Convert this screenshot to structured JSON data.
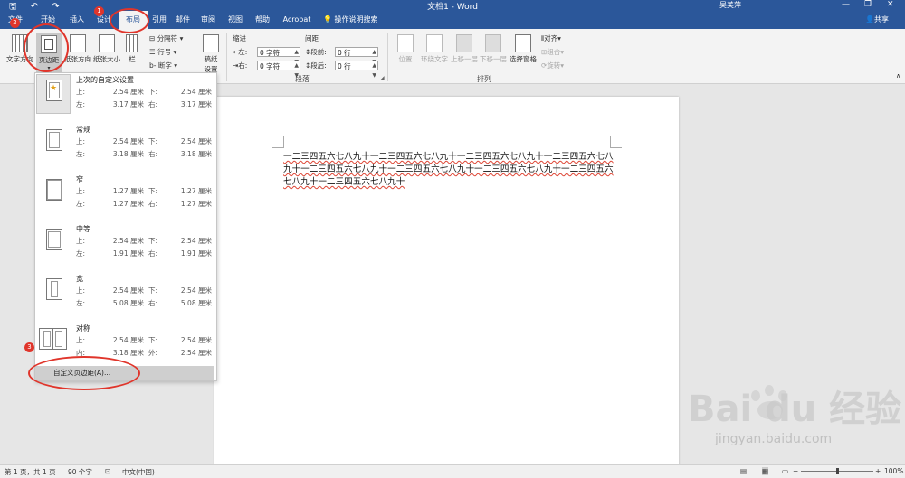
{
  "titlebar": {
    "quick_access": "🖫 ↶ ↷",
    "title": "文档1 - Word",
    "user": "吴美萍",
    "minimize": "—",
    "restore": "❐",
    "close": "✕"
  },
  "tabs": [
    {
      "label": "文件"
    },
    {
      "label": "开始"
    },
    {
      "label": "插入"
    },
    {
      "label": "设计"
    },
    {
      "label": "布局",
      "active": true
    },
    {
      "label": "引用"
    },
    {
      "label": "邮件"
    },
    {
      "label": "审阅"
    },
    {
      "label": "视图"
    },
    {
      "label": "帮助"
    },
    {
      "label": "Acrobat"
    }
  ],
  "tell_me": "操作说明搜索",
  "share": "共享",
  "ribbon": {
    "text_direction": "文字方向",
    "margins": "页边距",
    "orientation": "纸张方向",
    "size": "纸张大小",
    "columns": "栏",
    "breaks": "分隔符",
    "line_numbers": "行号",
    "hyphenation": "断字",
    "draft_paper_line1": "稿纸",
    "draft_paper_line2": "设置",
    "indent_label": "缩进",
    "indent_left_label": "左:",
    "indent_left_value": "0 字符",
    "indent_right_label": "右:",
    "indent_right_value": "0 字符",
    "spacing_label": "间距",
    "spacing_before_label": "段前:",
    "spacing_before_value": "0 行",
    "spacing_after_label": "段后:",
    "spacing_after_value": "0 行",
    "paragraph_group": "段落",
    "position": "位置",
    "wrap_text": "环绕文字",
    "bring_forward": "上移一层",
    "send_backward": "下移一层",
    "selection_pane": "选择窗格",
    "align": "对齐",
    "group": "组合",
    "rotate": "旋转",
    "arrange_group": "排列"
  },
  "margins_menu": {
    "options": [
      {
        "name": "上次的自定义设置",
        "top_label": "上:",
        "top": "2.54 厘米",
        "bottom_label": "下:",
        "bottom": "2.54 厘米",
        "left_label": "左:",
        "left": "3.17 厘米",
        "right_label": "右:",
        "right": "3.17 厘米"
      },
      {
        "name": "常规",
        "top_label": "上:",
        "top": "2.54 厘米",
        "bottom_label": "下:",
        "bottom": "2.54 厘米",
        "left_label": "左:",
        "left": "3.18 厘米",
        "right_label": "右:",
        "right": "3.18 厘米"
      },
      {
        "name": "窄",
        "top_label": "上:",
        "top": "1.27 厘米",
        "bottom_label": "下:",
        "bottom": "1.27 厘米",
        "left_label": "左:",
        "left": "1.27 厘米",
        "right_label": "右:",
        "right": "1.27 厘米"
      },
      {
        "name": "中等",
        "top_label": "上:",
        "top": "2.54 厘米",
        "bottom_label": "下:",
        "bottom": "2.54 厘米",
        "left_label": "左:",
        "left": "1.91 厘米",
        "right_label": "右:",
        "right": "1.91 厘米"
      },
      {
        "name": "宽",
        "top_label": "上:",
        "top": "2.54 厘米",
        "bottom_label": "下:",
        "bottom": "2.54 厘米",
        "left_label": "左:",
        "left": "5.08 厘米",
        "right_label": "右:",
        "right": "5.08 厘米"
      },
      {
        "name": "对称",
        "top_label": "上:",
        "top": "2.54 厘米",
        "bottom_label": "下:",
        "bottom": "2.54 厘米",
        "left_label": "内:",
        "left": "3.18 厘米",
        "right_label": "外:",
        "right": "2.54 厘米"
      }
    ],
    "custom": "自定义页边距(A)..."
  },
  "document": {
    "text": "一二三四五六七八九十一二三四五六七八九十一二三四五六七八九十一二三四五六七八九十一二三四五六七八九十一二三四五六七八九十一二三四五六七八九十一二三四五六七八九十一二三四五六七八九十"
  },
  "annotations": {
    "step1": "1",
    "step2": "2",
    "step3": "3"
  },
  "statusbar": {
    "page": "第 1 页，共 1 页",
    "words": "90 个字",
    "language": "中文(中国)",
    "zoom": "100%"
  },
  "watermark": {
    "logo": "Bai du 经验",
    "url": "jingyan.baidu.com"
  },
  "colors": {
    "ribbon_blue": "#2b579a",
    "annotation_red": "#e0352b"
  }
}
